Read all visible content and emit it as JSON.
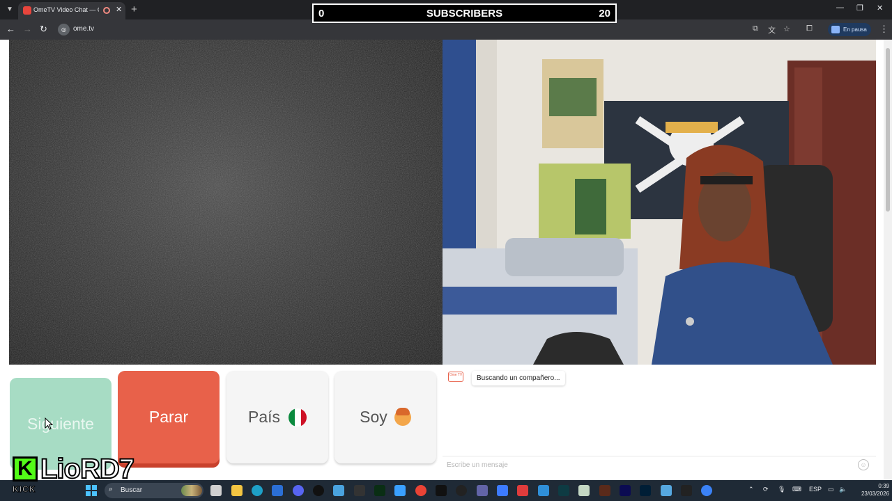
{
  "browser": {
    "tab_title": "OmeTV Video Chat — Ome",
    "tab_close": "✕",
    "new_tab": "+",
    "url": "ome.tv",
    "profile_status": "En pausa",
    "window_controls": {
      "minimize": "—",
      "maximize": "❐",
      "close": "✕"
    }
  },
  "overlay": {
    "subs_current": "0",
    "subs_title": "SUBSCRIBERS",
    "subs_goal": "20"
  },
  "controls": {
    "next_label": "Siguiente",
    "stop_label": "Parar",
    "country_label": "País",
    "gender_label": "Soy"
  },
  "chat": {
    "logo_text": "Ome TV",
    "status_message": "Buscando un compañero...",
    "input_placeholder": "Escribe un mensaje"
  },
  "stream_overlay": {
    "platform": "KICK",
    "channel": "LioRD7"
  },
  "taskbar": {
    "search_label": "Buscar",
    "language": "ESP",
    "time": "0:39",
    "date": "23/03/2026"
  },
  "colors": {
    "next_button": "#a7dcc4",
    "stop_button": "#e8614a",
    "kick_green": "#53fc18",
    "browser_bg": "#202124"
  }
}
